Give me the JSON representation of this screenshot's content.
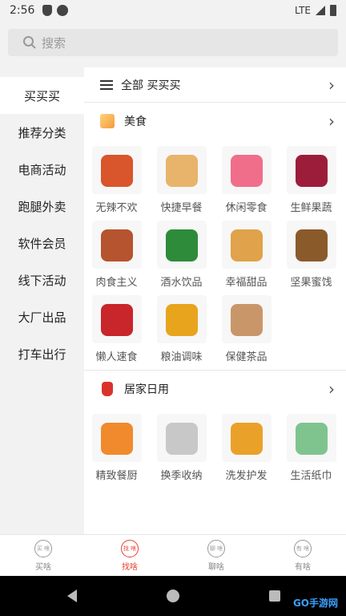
{
  "status_bar": {
    "time": "2:56",
    "network": "LTE"
  },
  "search": {
    "placeholder": "搜索"
  },
  "sidebar": {
    "items": [
      {
        "label": "买买买"
      },
      {
        "label": "推荐分类"
      },
      {
        "label": "电商活动"
      },
      {
        "label": "跑腿外卖"
      },
      {
        "label": "软件会员"
      },
      {
        "label": "线下活动"
      },
      {
        "label": "大厂出品"
      },
      {
        "label": "打车出行"
      }
    ]
  },
  "content": {
    "all_row": {
      "label": "全部 买买买"
    },
    "sections": [
      {
        "title": "美食",
        "items": [
          {
            "label": "无辣不欢",
            "color": "#d9552b"
          },
          {
            "label": "快捷早餐",
            "color": "#e8b46b"
          },
          {
            "label": "休闲零食",
            "color": "#f06e8a"
          },
          {
            "label": "生鲜果蔬",
            "color": "#9c1d3a"
          },
          {
            "label": "肉食主义",
            "color": "#b5542e"
          },
          {
            "label": "酒水饮品",
            "color": "#2e8b3a"
          },
          {
            "label": "幸福甜品",
            "color": "#e0a24a"
          },
          {
            "label": "坚果蜜饯",
            "color": "#8a5a2b"
          },
          {
            "label": "懒人速食",
            "color": "#c8262a"
          },
          {
            "label": "粮油调味",
            "color": "#e8a41c"
          },
          {
            "label": "保健茶品",
            "color": "#c9966a"
          }
        ]
      },
      {
        "title": "居家日用",
        "items": [
          {
            "label": "精致餐厨",
            "color": "#f08a2c"
          },
          {
            "label": "换季收纳",
            "color": "#c8c8c8"
          },
          {
            "label": "洗发护发",
            "color": "#e9a12a"
          },
          {
            "label": "生活纸巾",
            "color": "#7fc48f"
          }
        ]
      }
    ]
  },
  "tabbar": {
    "tabs": [
      {
        "label": "买啥",
        "icon_text": "买 啥"
      },
      {
        "label": "找啥",
        "icon_text": "找 啥"
      },
      {
        "label": "聊啥",
        "icon_text": "聊 啥"
      },
      {
        "label": "有啥",
        "icon_text": "有 啥"
      }
    ]
  },
  "watermark": "GO手游网"
}
